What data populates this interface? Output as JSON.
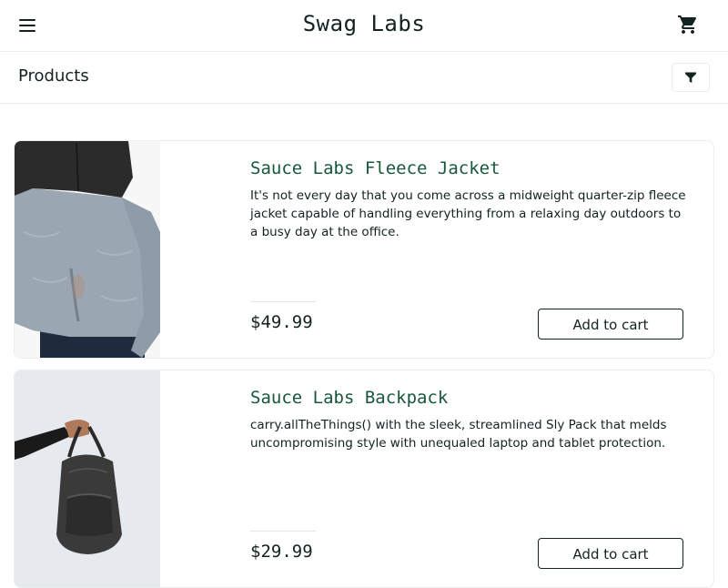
{
  "header": {
    "app_title": "Swag Labs",
    "menu_icon": "hamburger-menu-icon",
    "cart_icon": "shopping-cart-icon"
  },
  "secondary": {
    "title": "Products",
    "filter_icon": "filter-funnel-icon"
  },
  "products": [
    {
      "name": "Sauce Labs Fleece Jacket",
      "description": "It's not every day that you come across a midweight quarter-zip fleece jacket capable of handling everything from a relaxing day outdoors to a busy day at the office.",
      "price": "$49.99",
      "button_label": "Add to cart"
    },
    {
      "name": "Sauce Labs Backpack",
      "description": "carry.allTheThings() with the sleek, streamlined Sly Pack that melds uncompromising style with unequaled laptop and tablet protection.",
      "price": "$29.99",
      "button_label": "Add to cart"
    }
  ],
  "colors": {
    "text": "#132322",
    "product_name": "#18583a",
    "border": "#ededed"
  }
}
